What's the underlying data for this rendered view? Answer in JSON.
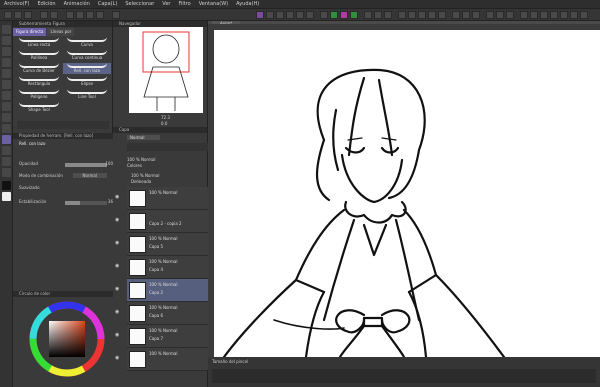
{
  "menu": [
    "Archivo(F)",
    "Edición",
    "Animación",
    "Capa(L)",
    "Seleccionar",
    "Ver",
    "Filtro",
    "Ventana(W)",
    "Ayuda(H)"
  ],
  "subtool": {
    "header": "Subherramienta Figura",
    "tabs": [
      "Figura directa",
      "Líneas por"
    ],
    "brushes": [
      "Línea recta",
      "Curva",
      "Polilínea",
      "Curva continua",
      "Curva de Bézier",
      "Rell. con lazo",
      "Rectángulo",
      "Elipse",
      "Polígono",
      "Line Tool",
      "Shape Tool"
    ],
    "selected_brush": "Rell. con lazo"
  },
  "tool_property": {
    "header": "Propiedad de herram. [Rell. con lazo]",
    "tool_name": "Rell. con lazo",
    "rows": [
      {
        "label": "Opacidad",
        "value": "100"
      },
      {
        "label": "Modo de combinación",
        "value": "Normal"
      },
      {
        "label": "Suavizado",
        "value": ""
      },
      {
        "label": "Estabilización",
        "value": "36"
      }
    ]
  },
  "color_panel": {
    "header": "Círculo de color"
  },
  "navigator": {
    "header": "Navegador",
    "zoom": "72.3",
    "angle": "0.0"
  },
  "layer_panel": {
    "header": "Capa",
    "blend_mode": "Normal",
    "layers": [
      {
        "l1": "100 % Normal",
        "l2": "Colores"
      },
      {
        "l1": "100 % Normal",
        "l2": "Delineado"
      },
      {
        "l1": "100 % Normal",
        "l2": ""
      },
      {
        "l1": "",
        "l2": "Capa 2 - copia 2"
      },
      {
        "l1": "100 % Normal",
        "l2": "Capa 5"
      },
      {
        "l1": "100 % Normal",
        "l2": "Capa 4"
      },
      {
        "l1": "100 % Normal",
        "l2": "Capa 2"
      },
      {
        "l1": "100 % Normal",
        "l2": "Capa 6"
      },
      {
        "l1": "100 % Normal",
        "l2": "Capa 7"
      },
      {
        "l1": "100 % Normal",
        "l2": ""
      }
    ]
  },
  "canvas_tab": "Anim*",
  "bottom": {
    "label": "Tamaño del pincel"
  },
  "colors": {
    "accent": "#6b5fa6",
    "selection": "#56607e"
  }
}
